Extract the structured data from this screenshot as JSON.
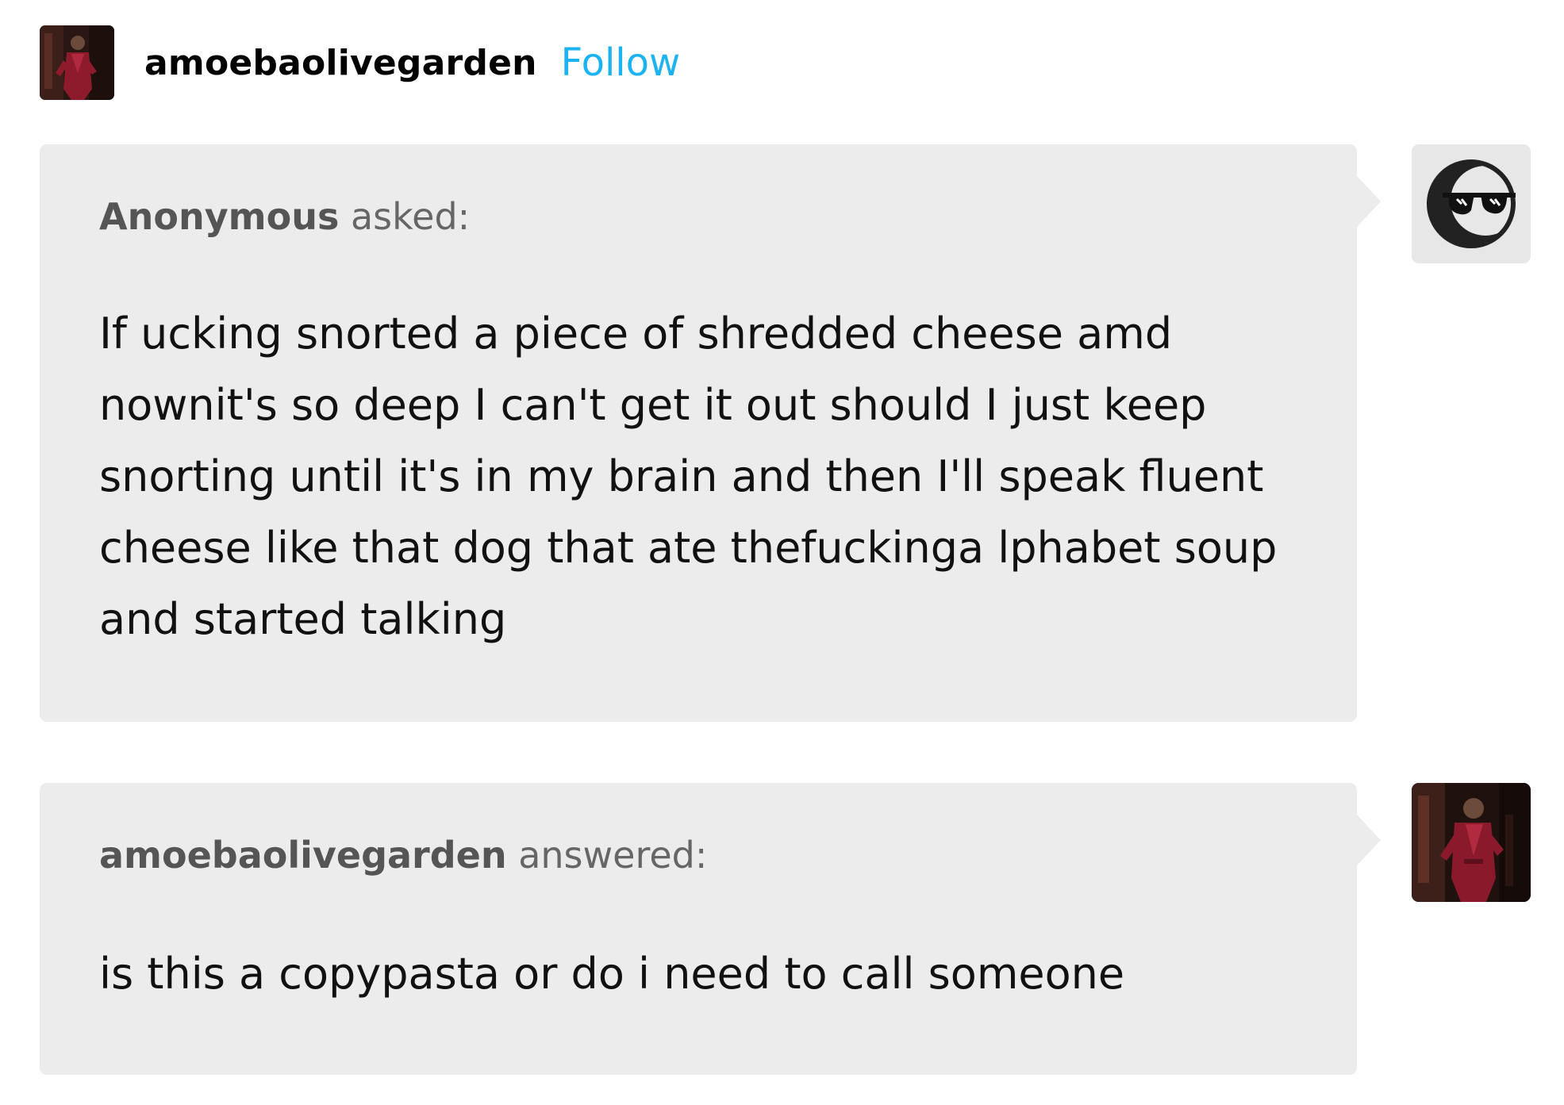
{
  "header": {
    "blog_name": "amoebaolivegarden",
    "follow_label": "Follow"
  },
  "ask": {
    "asker": "Anonymous",
    "verb": "asked:",
    "question": "If ucking snorted a piece of shredded cheese amd nownit's so deep I can't get it out should I just keep snorting until it's in my brain and then I'll speak fluent cheese like that dog that ate thefuckinga lphabet soup and started talking",
    "asker_avatar_icon": "anonymous-sunglasses-icon"
  },
  "answer": {
    "answerer": "amoebaolivegarden",
    "verb": "answered:",
    "text": "is this a copypasta or do i need to call someone",
    "answerer_avatar_icon": "user-photo-avatar"
  },
  "colors": {
    "follow": "#1db3f0",
    "bubble_bg": "#ececec",
    "attribution": "#666666",
    "body_text": "#111111"
  }
}
